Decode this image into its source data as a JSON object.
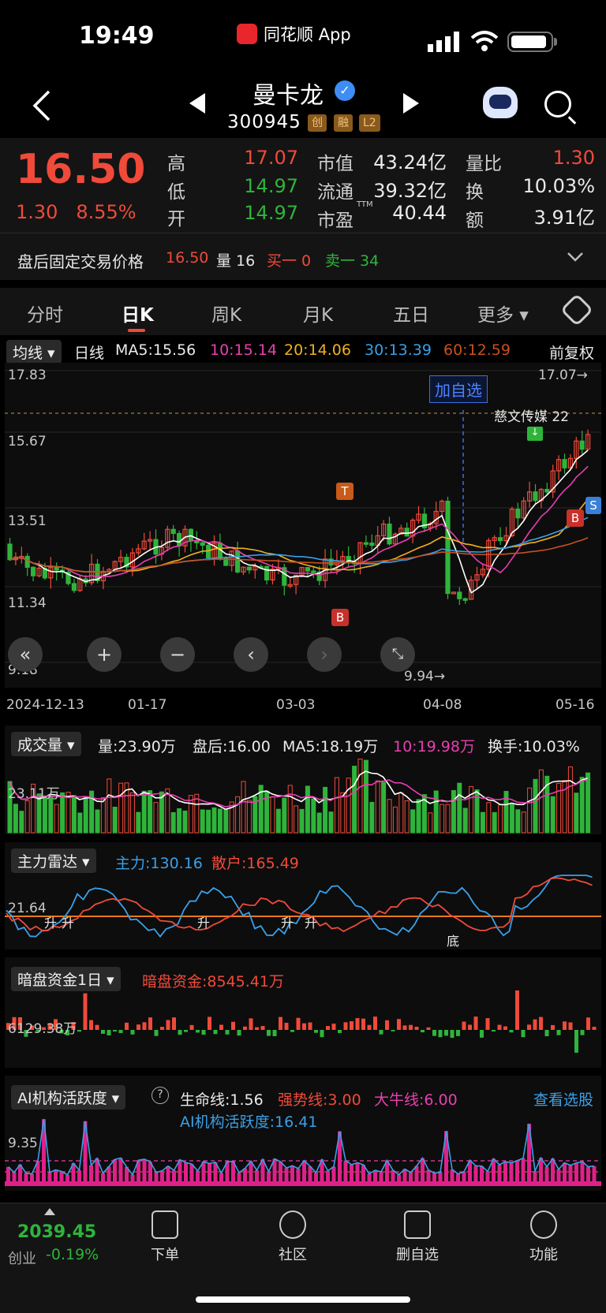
{
  "status_bar": {
    "time": "19:49",
    "app_name": "同花顺 App"
  },
  "header": {
    "stock_name": "曼卡龙",
    "code": "300945",
    "tags": [
      "创",
      "融",
      "L2"
    ]
  },
  "quote": {
    "price": "16.50",
    "change": "1.30",
    "change_pct": "8.55%",
    "high_label": "高",
    "high": "17.07",
    "low_label": "低",
    "low": "14.97",
    "open_label": "开",
    "open": "14.97",
    "mktcap_label": "市值",
    "mktcap": "43.24亿",
    "float_label": "流通",
    "float": "39.32亿",
    "pe_label": "市盈",
    "pe_sup": "TTM",
    "pe": "40.44",
    "volratio_label": "量比",
    "volratio": "1.30",
    "turnover_label": "换",
    "turnover": "10.03%",
    "amount_label": "额",
    "amount": "3.91亿"
  },
  "after_hours": {
    "label": "盘后固定交易价格",
    "price": "16.50",
    "vol": "量 16",
    "buy": "买一 0",
    "sell": "卖一 34"
  },
  "tabs": [
    "分时",
    "日K",
    "周K",
    "月K",
    "五日",
    "更多"
  ],
  "ma_bar": {
    "selector": "均线",
    "period": "日线",
    "ma5": "MA5:15.56",
    "ma10": "10:15.14",
    "ma20": "20:14.06",
    "ma30": "30:13.39",
    "ma60": "60:12.59",
    "adjust": "前复权"
  },
  "kchart": {
    "y_labels": [
      "17.83",
      "15.67",
      "13.51",
      "11.34",
      "9.18"
    ],
    "high_mark": "17.07→",
    "low_mark": "9.94→",
    "add_watch": "加自选",
    "event": "慈文传媒 22",
    "dates": [
      "2024-12-13",
      "01-17",
      "03-03",
      "04-08",
      "05-16"
    ]
  },
  "volume": {
    "selector": "成交量",
    "vol": "量:23.90万",
    "after": "盘后:16.00",
    "ma5": "MA5:18.19万",
    "ma10": "10:19.98万",
    "turnover": "换手:10.03%",
    "y_label": "23.11万"
  },
  "radar": {
    "selector": "主力雷达",
    "main": "主力:130.16",
    "retail": "散户:165.49",
    "y_label": "21.64",
    "marks": [
      "升",
      "升",
      "升",
      "升",
      "升",
      "底"
    ]
  },
  "dark": {
    "selector": "暗盘资金1日",
    "value": "暗盘资金:8545.41万",
    "y_label": "6129.38万"
  },
  "ai": {
    "selector": "AI机构活跃度",
    "life": "生命线:1.56",
    "strong": "强势线:3.00",
    "bull": "大牛线:6.00",
    "view": "查看选股",
    "activity": "AI机构活跃度:16.41",
    "y_label": "9.35"
  },
  "bottom_bar": {
    "index_value": "2039.45",
    "index_name": "创业",
    "index_change": "-0.19%",
    "items": [
      "下单",
      "社区",
      "删自选",
      "功能"
    ]
  },
  "colors": {
    "up": "#f04a3a",
    "down": "#2fb43b",
    "ma5": "#ffffff",
    "ma10": "#e83fb0",
    "ma20": "#f0b020",
    "ma30": "#3aa0e8",
    "ma60": "#c85020"
  }
}
